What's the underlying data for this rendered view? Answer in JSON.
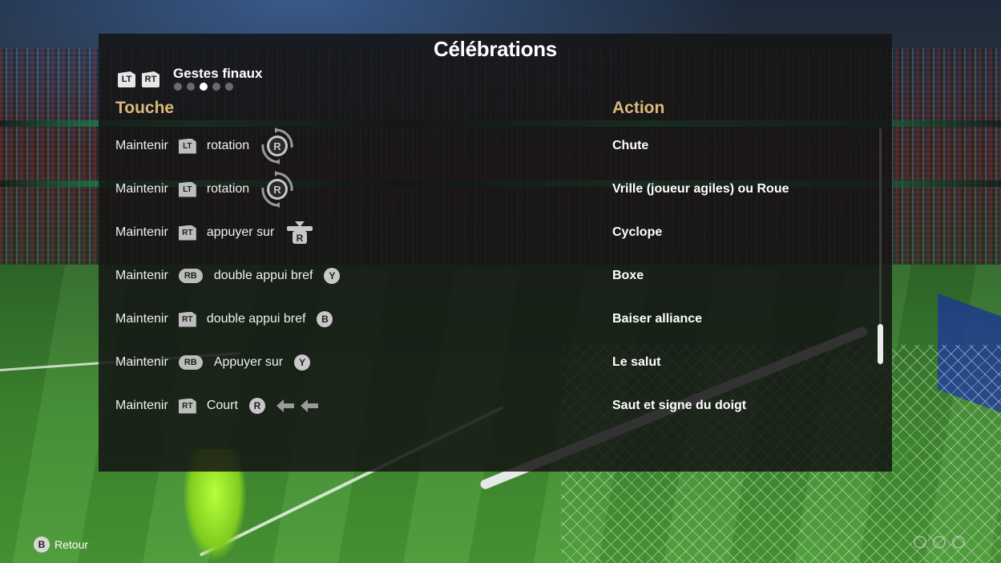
{
  "screen": {
    "title": "Célébrations",
    "tabs": {
      "left_trigger": "LT",
      "right_trigger": "RT",
      "current": "Gestes finaux",
      "page_count": 5,
      "active_index": 2
    },
    "columns": {
      "input": "Touche",
      "action": "Action"
    },
    "rows": [
      {
        "input": {
          "verb": "Maintenir",
          "modifier": "LT",
          "motion": "rotation",
          "stick": "R"
        },
        "action": "Chute"
      },
      {
        "input": {
          "verb": "Maintenir",
          "modifier": "LT",
          "motion": "rotation",
          "stick": "R"
        },
        "action": "Vrille (joueur agiles) ou Roue"
      },
      {
        "input": {
          "verb": "Maintenir",
          "modifier": "RT",
          "motion": "appuyer sur",
          "stick": "R"
        },
        "action": "Cyclope"
      },
      {
        "input": {
          "verb": "Maintenir",
          "modifier": "RB",
          "motion": "double appui bref",
          "button": "Y"
        },
        "action": "Boxe"
      },
      {
        "input": {
          "verb": "Maintenir",
          "modifier": "RT",
          "motion": "double appui bref",
          "button": "B"
        },
        "action": "Baiser alliance"
      },
      {
        "input": {
          "verb": "Maintenir",
          "modifier": "RB",
          "motion": "Appuyer sur",
          "button": "Y"
        },
        "action": "Le salut"
      },
      {
        "input": {
          "verb": "Maintenir",
          "modifier": "RT",
          "motion": "Court",
          "button": "R"
        },
        "action": "Saut et signe du doigt"
      }
    ],
    "scroll": {
      "position_fraction": 0.83
    }
  },
  "footer": {
    "back_button": "B",
    "back_label": "Retour"
  },
  "colors": {
    "panel_bg": "#141414",
    "column_header": "#d9b97a",
    "text": "#ffffff",
    "active_dot": "#ffffff",
    "inactive_dot": "#6b6b6b"
  },
  "icons": {
    "rotate_stick": "rotate-stick-icon",
    "press_stick": "press-stick-icon",
    "arrow_left": "arrow-left-icon"
  }
}
